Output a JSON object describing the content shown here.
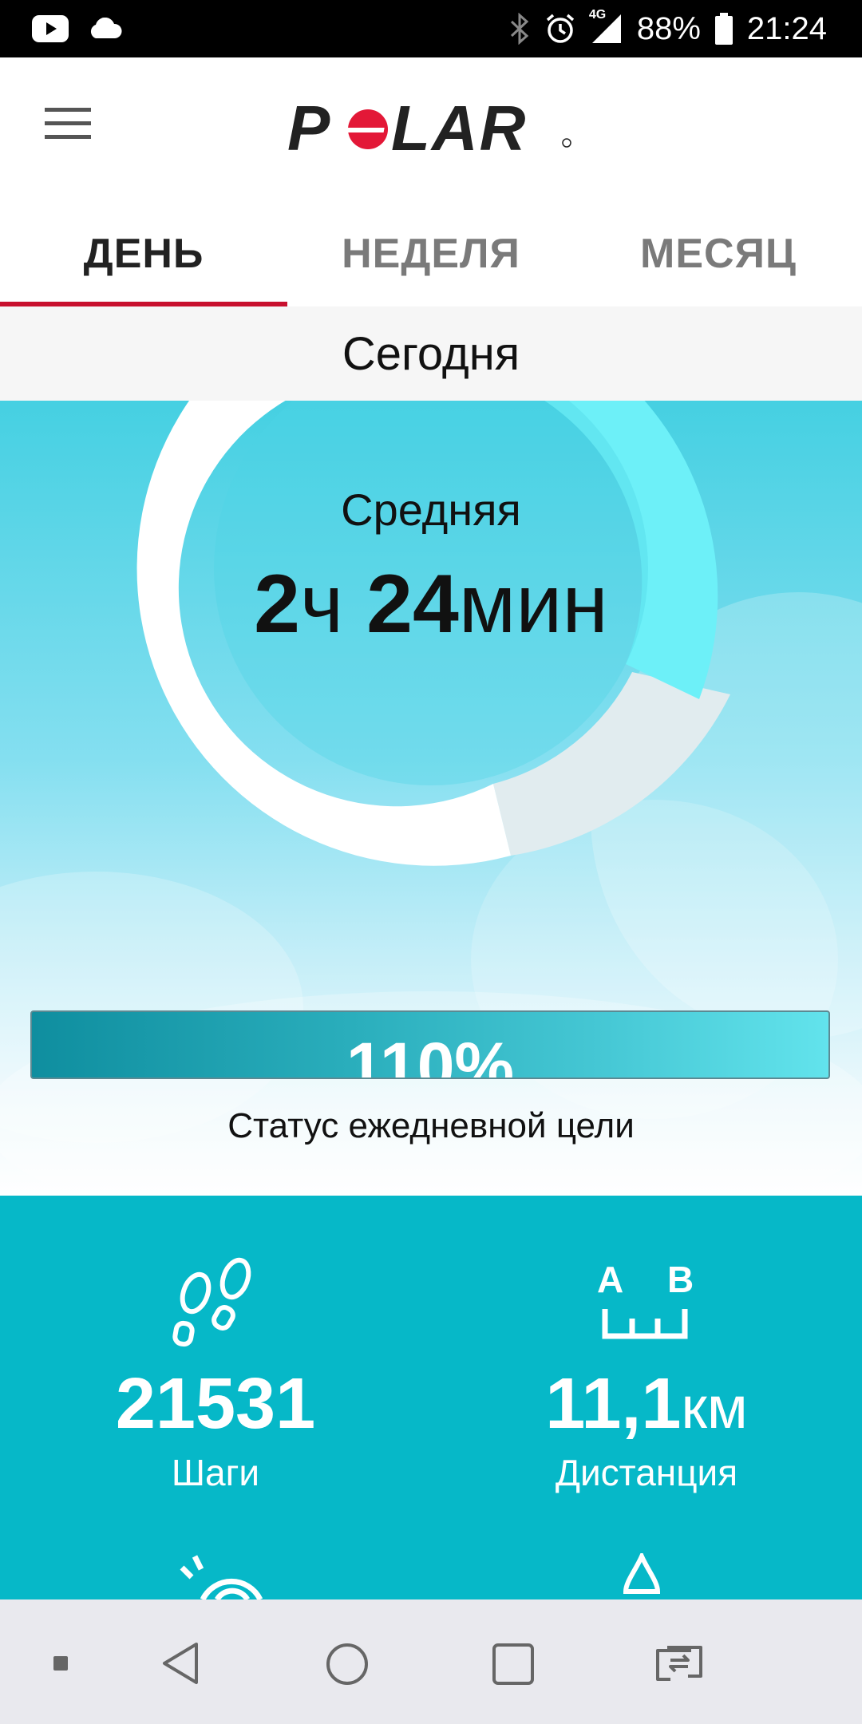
{
  "status_bar": {
    "left_icons": [
      "youtube-icon",
      "cloud-icon"
    ],
    "right_icons": [
      "bluetooth-icon",
      "alarm-icon",
      "signal-4g-icon",
      "battery-icon"
    ],
    "network": "4G",
    "battery": "88%",
    "time": "21:24"
  },
  "header": {
    "menu_icon": "hamburger-menu-icon",
    "logo": "POLAR"
  },
  "tabs": [
    {
      "label": "ДЕНЬ",
      "active": true
    },
    {
      "label": "НЕДЕЛЯ",
      "active": false
    },
    {
      "label": "МЕСЯЦ",
      "active": false
    }
  ],
  "day_header": "Сегодня",
  "activity": {
    "level_label": "Средняя",
    "hours": "2",
    "hours_unit": "ч",
    "minutes": "24",
    "minutes_unit": "мин"
  },
  "goal": {
    "percent_text": "110%",
    "caption": "Статус ежедневной цели"
  },
  "stats": {
    "steps": {
      "icon": "footsteps-icon",
      "value": "21531",
      "label": "Шаги"
    },
    "distance": {
      "icon": "distance-ab-icon",
      "icon_letters": [
        "A",
        "B"
      ],
      "value": "11,1",
      "unit": "км",
      "label": "Дистанция"
    }
  },
  "nav_bar": {
    "buttons": [
      "small-square-icon",
      "back-icon",
      "home-icon",
      "recents-icon",
      "switch-apps-icon"
    ]
  },
  "colors": {
    "brand_red": "#c8102e",
    "stats_teal": "#06b8c8",
    "sky_top": "#45d0e2"
  }
}
